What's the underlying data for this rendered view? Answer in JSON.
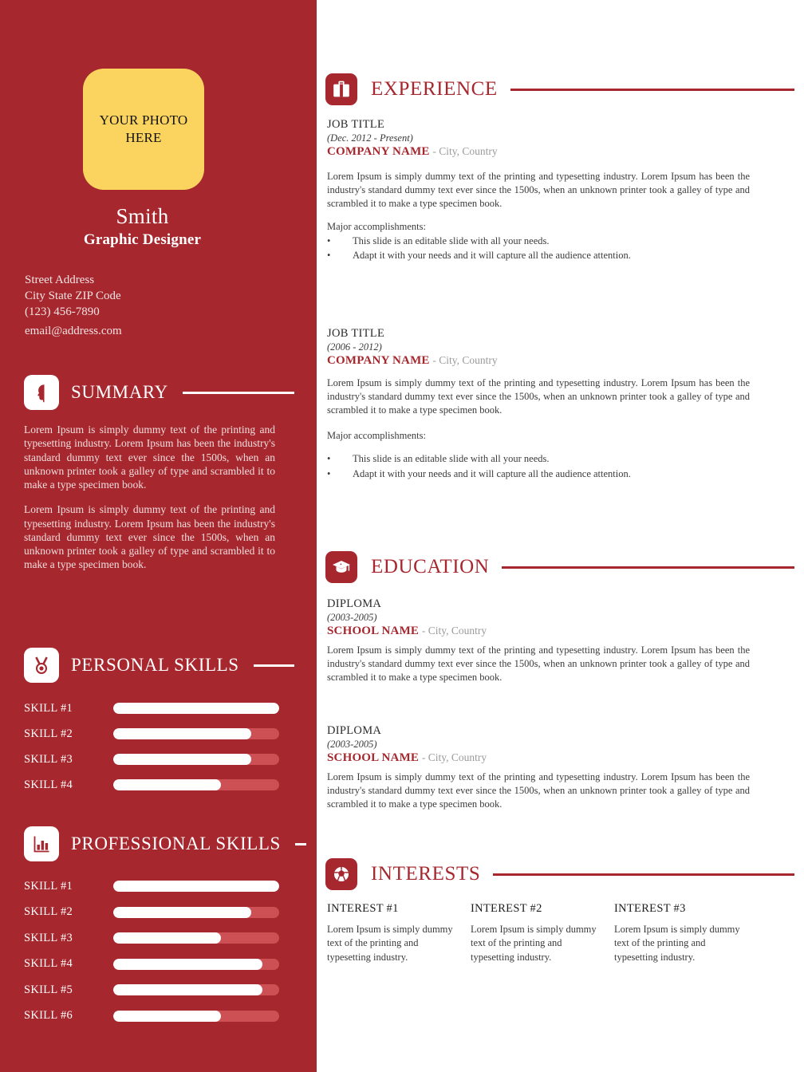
{
  "theme": {
    "panel_red": "#A6272E",
    "accent_red": "#A6272E",
    "photo_yellow": "#FBD45F",
    "skill_track_red": "#CD5054",
    "skill_fill_white": "#FFFFFF"
  },
  "sidebar": {
    "photo_placeholder": "YOUR PHOTO HERE",
    "name": "Smith",
    "role": "Graphic Designer",
    "contact": {
      "street": "Street Address",
      "city_zip": "City State ZIP Code",
      "phone": "(123) 456-7890",
      "email": "email@address.com"
    },
    "summary": {
      "title": "SUMMARY",
      "icon": "head-silhouette-icon",
      "paragraphs": [
        "Lorem Ipsum is simply dummy text of the printing and typesetting industry. Lorem Ipsum has been the industry's standard dummy text ever since the 1500s, when an unknown printer took a galley of type and scrambled it to make a type specimen book.",
        "Lorem Ipsum is simply dummy text of the printing and typesetting industry. Lorem Ipsum has been the industry's standard dummy text ever since the 1500s, when an unknown printer took a galley of type and scrambled it to make a type specimen book."
      ]
    },
    "personal_skills": {
      "title": "PERSONAL SKILLS",
      "icon": "medal-icon",
      "items": [
        {
          "label": "SKILL #1",
          "value": 100
        },
        {
          "label": "SKILL #2",
          "value": 83
        },
        {
          "label": "SKILL #3",
          "value": 83
        },
        {
          "label": "SKILL #4",
          "value": 65
        }
      ]
    },
    "professional_skills": {
      "title": "PROFESSIONAL SKILLS",
      "icon": "bar-chart-icon",
      "items": [
        {
          "label": "SKILL #1",
          "value": 100
        },
        {
          "label": "SKILL #2",
          "value": 83
        },
        {
          "label": "SKILL #3",
          "value": 65
        },
        {
          "label": "SKILL #4",
          "value": 90
        },
        {
          "label": "SKILL #5",
          "value": 90
        },
        {
          "label": "SKILL #6",
          "value": 65
        }
      ]
    }
  },
  "main": {
    "experience": {
      "title": "EXPERIENCE",
      "icon": "briefcase-icon",
      "entries": [
        {
          "job_title": "JOB TITLE",
          "dates": "(Dec. 2012 - Present)",
          "company": "COMPANY NAME",
          "location": "- City, Country",
          "description": "Lorem Ipsum is simply dummy text of the printing and typesetting industry. Lorem Ipsum has been the industry's standard dummy text ever since the 1500s, when an unknown printer took a galley of type and scrambled it to make a type specimen book.",
          "accomplishments_label": "Major accomplishments:",
          "bullets": [
            "This slide is an editable slide with all your needs.",
            "Adapt it with your needs and it will capture all the audience attention."
          ]
        },
        {
          "job_title": "JOB TITLE",
          "dates": "(2006 - 2012)",
          "company": "COMPANY NAME",
          "location": "- City, Country",
          "description": "Lorem Ipsum is simply dummy text of the printing and typesetting industry. Lorem Ipsum has been the industry's standard dummy text ever since the 1500s, when an unknown printer took a galley of type and scrambled it to make a type specimen book.",
          "accomplishments_label": "Major accomplishments:",
          "bullets": [
            "This slide is an editable slide with all your needs.",
            "Adapt it with your needs and it will capture all the audience attention."
          ]
        }
      ]
    },
    "education": {
      "title": "EDUCATION",
      "icon": "graduation-cap-icon",
      "entries": [
        {
          "diploma": "DIPLOMA",
          "dates": "(2003-2005)",
          "school": "SCHOOL NAME",
          "location": "- City, Country",
          "description": "Lorem Ipsum is simply dummy text of the printing and typesetting industry. Lorem Ipsum has been the industry's standard dummy text ever since the 1500s, when an unknown printer took a galley of type and scrambled it to make a type specimen book."
        },
        {
          "diploma": "DIPLOMA",
          "dates": "(2003-2005)",
          "school": "SCHOOL NAME",
          "location": "- City, Country",
          "description": "Lorem Ipsum is simply dummy text of the printing and typesetting industry. Lorem Ipsum has been the industry's standard dummy text ever since the 1500s, when an unknown printer took a galley of type and scrambled it to make a type specimen book."
        }
      ]
    },
    "interests": {
      "title": "INTERESTS",
      "icon": "soccer-ball-icon",
      "items": [
        {
          "title": "INTEREST #1",
          "text": "Lorem Ipsum is simply dummy text of the printing and typesetting industry."
        },
        {
          "title": "INTEREST #2",
          "text": "Lorem Ipsum is simply dummy text of the printing and typesetting industry."
        },
        {
          "title": "INTEREST #3",
          "text": "Lorem Ipsum is simply dummy text of the printing and typesetting industry."
        }
      ]
    }
  },
  "bullet_glyph": "•"
}
